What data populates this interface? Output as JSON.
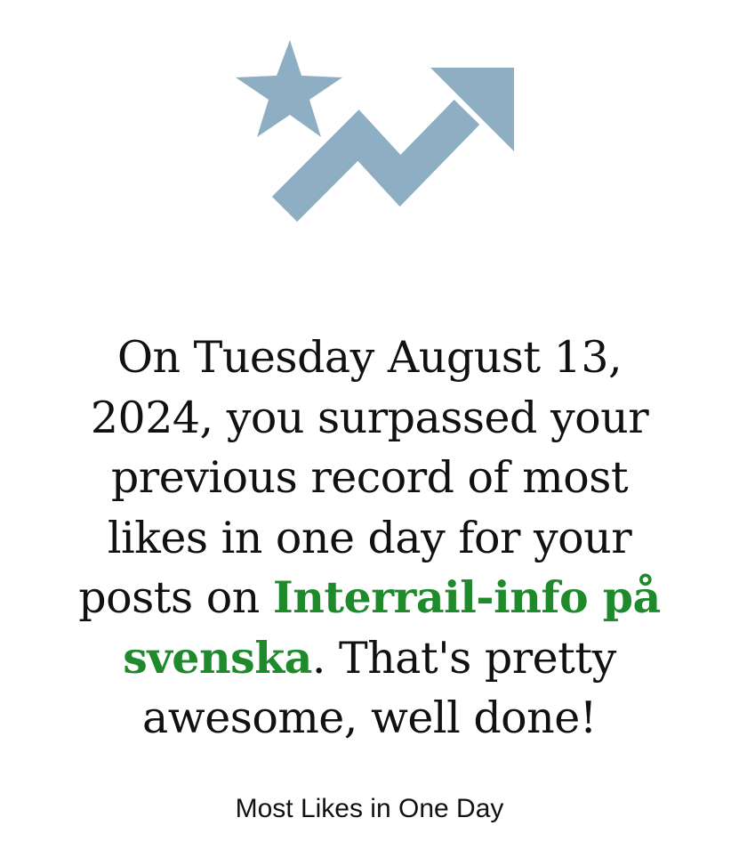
{
  "badge": {
    "icon": "star-trending-up-icon",
    "color": "#8eaec4"
  },
  "message": {
    "prefix": "On Tuesday August 13, 2024, you surpassed your previous record of most likes in one day for your posts on ",
    "group_name": "Interrail-info på svenska",
    "suffix": ". That's pretty awesome, well done!",
    "link_color": "#1f8a2c"
  },
  "caption": "Most Likes in One Day"
}
